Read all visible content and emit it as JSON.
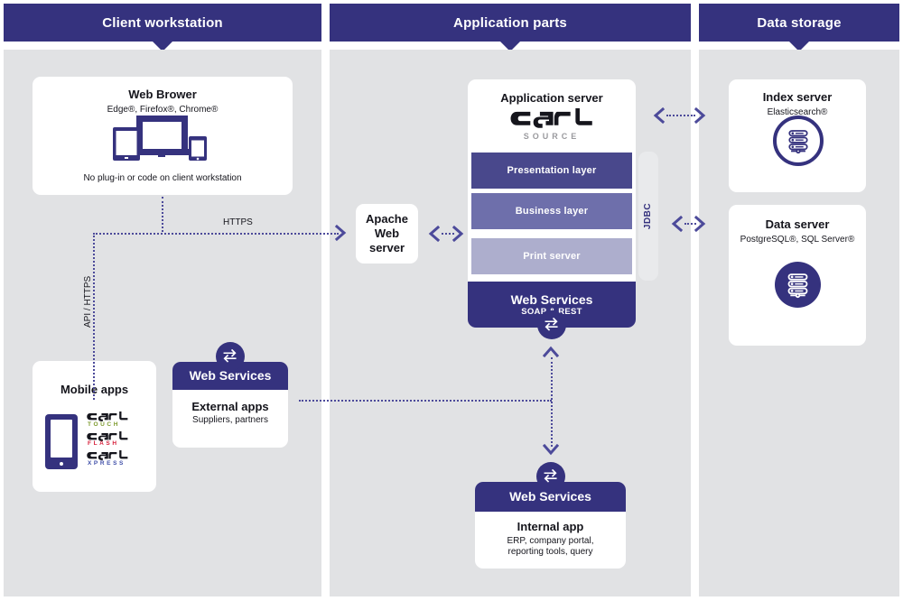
{
  "columns": [
    {
      "id": "client",
      "title": "Client workstation"
    },
    {
      "id": "app",
      "title": "Application parts"
    },
    {
      "id": "storage",
      "title": "Data storage"
    }
  ],
  "client": {
    "browser": {
      "title": "Web Brower",
      "subtitle": "Edge®, Firefox®, Chrome®",
      "icon": "devices-icon",
      "footnote": "No plug-in or code on client workstation"
    },
    "mobile": {
      "title": "Mobile apps",
      "icon": "smartphone-icon",
      "logos": [
        {
          "word": "carl",
          "sub": "TOUCH",
          "sub_color": "#7d9a2e"
        },
        {
          "word": "carl",
          "sub": "FLASH",
          "sub_color": "#d61f3a"
        },
        {
          "word": "carl",
          "sub": "XPRESS",
          "sub_color": "#3f4fa8"
        }
      ]
    },
    "external": {
      "band_label": "Web Services",
      "badge_icon": "exchange-icon",
      "title": "External apps",
      "subtitle": "Suppliers, partners"
    }
  },
  "app": {
    "apache": {
      "line1": "Apache",
      "line2": "Web",
      "line3": "server"
    },
    "server": {
      "title": "Application server",
      "logo_word": "carl",
      "logo_sub": "SOURCE",
      "layers": [
        {
          "label": "Presentation layer",
          "tone": "dark"
        },
        {
          "label": "Business layer",
          "tone": "mid"
        },
        {
          "label": "Print server",
          "tone": "light"
        }
      ],
      "web_services": {
        "title": "Web Services",
        "subtitle": "SOAP & REST",
        "badge_icon": "exchange-icon"
      },
      "jdbc_label": "JDBC"
    },
    "internal": {
      "band_label": "Web Services",
      "badge_icon": "exchange-icon",
      "title": "Internal app",
      "subtitle_line1": "ERP, company portal,",
      "subtitle_line2": "reporting tools, query"
    }
  },
  "storage": {
    "index": {
      "title": "Index server",
      "subtitle": "Elasticsearch®",
      "icon": "database-stack-outline-icon"
    },
    "data": {
      "title": "Data server",
      "subtitle": "PostgreSQL®, SQL Server®",
      "icon": "database-stack-filled-icon"
    }
  },
  "connectors": {
    "https_label": "HTTPS",
    "api_https_label": "API / HTTPS"
  },
  "colors": {
    "brand_dark": "#35327e",
    "layer_dark": "#49488c",
    "layer_mid": "#6e6fab",
    "layer_light": "#adaecd",
    "column_bg": "#e1e2e4",
    "connector": "#4c4a9a",
    "page_bg": "#ffffff"
  }
}
